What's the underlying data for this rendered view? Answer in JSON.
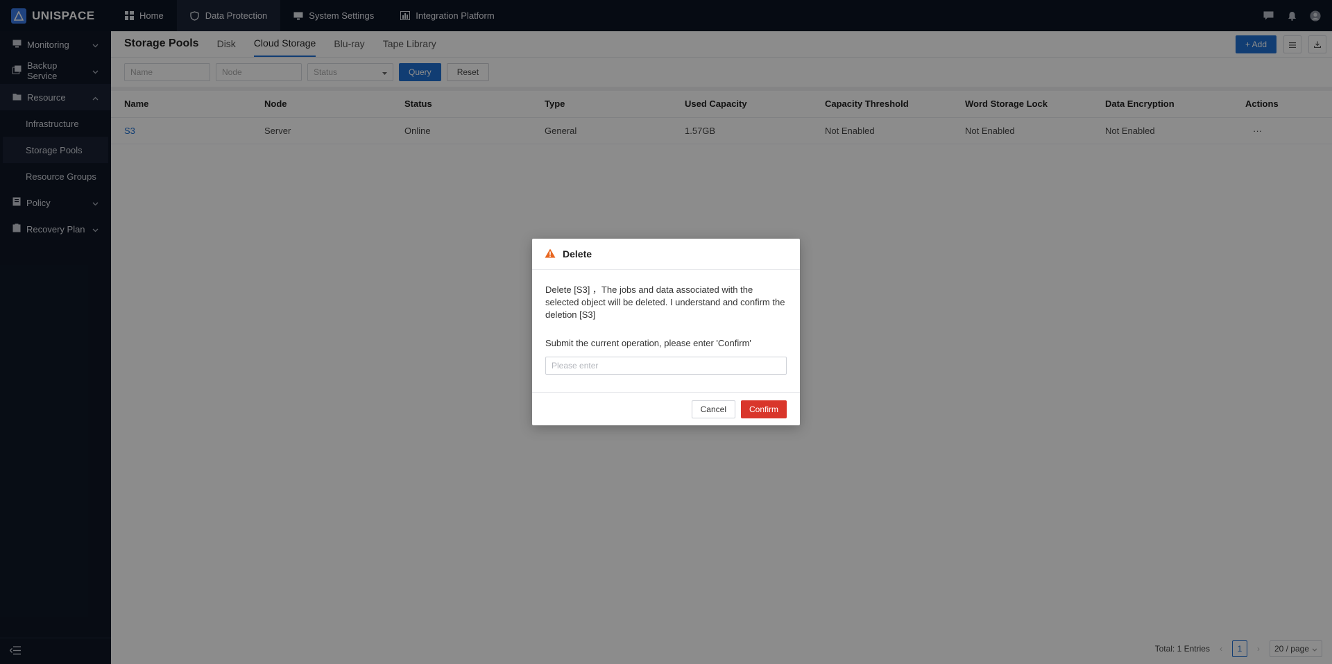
{
  "brand": {
    "name": "UNISPACE"
  },
  "topnav": [
    {
      "label": "Home",
      "icon": "dashboard-icon"
    },
    {
      "label": "Data Protection",
      "icon": "shield-icon",
      "active": true
    },
    {
      "label": "System Settings",
      "icon": "monitor-gear-icon"
    },
    {
      "label": "Integration Platform",
      "icon": "chart-icon"
    }
  ],
  "sidebar": {
    "groups": [
      {
        "label": "Monitoring"
      },
      {
        "label": "Backup Service"
      },
      {
        "label": "Resource",
        "open": true
      },
      {
        "label": "Policy"
      },
      {
        "label": "Recovery Plan"
      }
    ],
    "resource_items": [
      "Infrastructure",
      "Storage Pools",
      "Resource Groups"
    ]
  },
  "tabs": {
    "title": "Storage Pools",
    "items": [
      "Disk",
      "Cloud Storage",
      "Blu-ray",
      "Tape Library"
    ],
    "add_label": "+ Add"
  },
  "filters": {
    "name_placeholder": "Name",
    "node_placeholder": "Node",
    "status_placeholder": "Status",
    "query_label": "Query",
    "reset_label": "Reset"
  },
  "table": {
    "columns": [
      "Name",
      "Node",
      "Status",
      "Type",
      "Used Capacity",
      "Capacity Threshold",
      "Word Storage Lock",
      "Data Encryption",
      "Actions"
    ],
    "rows": [
      [
        "S3",
        "Server",
        "Online",
        "General",
        "1.57GB",
        "Not Enabled",
        "Not Enabled",
        "Not Enabled",
        "···"
      ]
    ]
  },
  "pager": {
    "total": "Total: 1 Entries",
    "current": "1",
    "size": "20 / page"
  },
  "modal": {
    "title": "Delete",
    "message": "Delete [S3] ，The jobs and data associated with the selected object will be deleted. I understand and confirm the deletion [S3]",
    "prompt": "Submit the current operation, please enter 'Confirm'",
    "placeholder": "Please enter",
    "cancel": "Cancel",
    "confirm": "Confirm"
  },
  "colors": {
    "accent": "#1f6fd1",
    "danger": "#d9362b",
    "warning": "#e8661f",
    "topbar": "#0c1423"
  }
}
